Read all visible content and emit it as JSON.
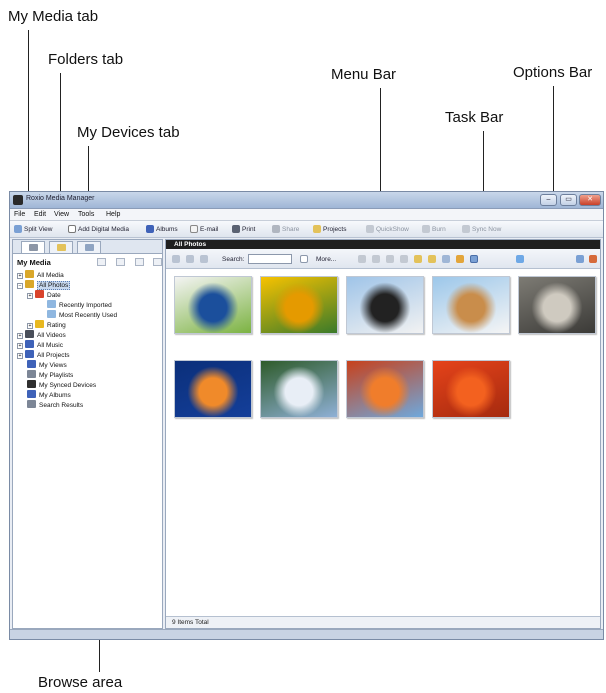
{
  "callouts": {
    "my_media_tab": "My Media tab",
    "folders_tab": "Folders tab",
    "menu_bar": "Menu Bar",
    "options_bar": "Options Bar",
    "task_bar": "Task Bar",
    "my_devices_tab": "My Devices tab",
    "browse_area": "Browse area"
  },
  "window": {
    "title": "Roxio Media Manager",
    "controls": {
      "minimize": "–",
      "maximize": "▭",
      "close": "✕"
    }
  },
  "menu": [
    "File",
    "Edit",
    "View",
    "Tools",
    "Help"
  ],
  "taskbar": {
    "split_view": "Split View",
    "add_digital_media": "Add Digital Media",
    "albums": "Albums",
    "email": "E-mail",
    "print": "Print",
    "share": "Share",
    "projects": "Projects",
    "quickshow": "QuickShow",
    "burn": "Burn",
    "sync_now": "Sync Now"
  },
  "left_pane": {
    "heading": "My Media",
    "tree": [
      {
        "label": "All Media",
        "icon": "media-icon",
        "color": "#d9a72a",
        "level": 0,
        "expander": "+"
      },
      {
        "label": "All Photos",
        "icon": "photos-icon",
        "color": "#d9a72a",
        "level": 0,
        "expander": "−",
        "selected": true
      },
      {
        "label": "Date",
        "icon": "clock-icon",
        "color": "#d9432b",
        "level": 1,
        "expander": "+"
      },
      {
        "label": "Recently Imported",
        "icon": "folder-icon",
        "color": "#8fb7e0",
        "level": 2
      },
      {
        "label": "Most Recently Used",
        "icon": "folder-icon",
        "color": "#8fb7e0",
        "level": 2
      },
      {
        "label": "Rating",
        "icon": "star-icon",
        "color": "#e8b820",
        "level": 1,
        "expander": "+"
      },
      {
        "label": "All Videos",
        "icon": "video-icon",
        "color": "#4a4f5a",
        "level": 0,
        "expander": "+"
      },
      {
        "label": "All Music",
        "icon": "music-icon",
        "color": "#3f62b8",
        "level": 0,
        "expander": "+"
      },
      {
        "label": "All Projects",
        "icon": "projects-icon",
        "color": "#3f62b8",
        "level": 0,
        "expander": "+"
      },
      {
        "label": "My Views",
        "icon": "views-icon",
        "color": "#3f62b8",
        "level": 0
      },
      {
        "label": "My Playlists",
        "icon": "playlist-icon",
        "color": "#7c8696",
        "level": 0
      },
      {
        "label": "My Synced Devices",
        "icon": "device-icon",
        "color": "#2f2f2f",
        "level": 0
      },
      {
        "label": "My Albums",
        "icon": "album-icon",
        "color": "#3f62b8",
        "level": 0
      },
      {
        "label": "Search Results",
        "icon": "search-icon",
        "color": "#7c8696",
        "level": 0
      }
    ]
  },
  "right_pane": {
    "heading": "All Photos",
    "search_label": "Search:",
    "more_label": "More...",
    "status": "9 Items Total",
    "thumbnails": [
      {
        "name": "screenshot-thumbnail",
        "palette": [
          "#f4f4f4",
          "#1b4f9c",
          "#7cb342"
        ]
      },
      {
        "name": "tulips-thumbnail",
        "palette": [
          "#f7c200",
          "#e59a00",
          "#3a7a2a"
        ]
      },
      {
        "name": "penguins-thumbnail",
        "palette": [
          "#9fc4e8",
          "#222222",
          "#f2f2f2"
        ]
      },
      {
        "name": "lighthouse-thumbnail",
        "palette": [
          "#9cc7ea",
          "#c98d4b",
          "#f5f5f5"
        ]
      },
      {
        "name": "koala-thumbnail",
        "palette": [
          "#7d7b74",
          "#cfcac0",
          "#3b3a37"
        ]
      },
      {
        "name": "jellyfish-thumbnail",
        "palette": [
          "#0b2f7a",
          "#f08a2a",
          "#143f9a"
        ]
      },
      {
        "name": "hydrangeas-thumbnail",
        "palette": [
          "#2e5b2a",
          "#e8eef6",
          "#8fb0d6"
        ]
      },
      {
        "name": "desert-thumbnail",
        "palette": [
          "#c7411c",
          "#f07d2b",
          "#6fa8dc"
        ]
      },
      {
        "name": "chrysanthemum-thumbnail",
        "palette": [
          "#e5431a",
          "#f3611f",
          "#a52a0f"
        ]
      }
    ]
  }
}
